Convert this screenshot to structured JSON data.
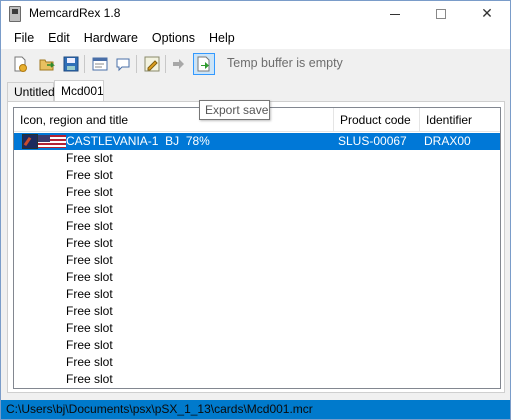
{
  "window": {
    "title": "MemcardRex 1.8",
    "icon": "memory-card-icon",
    "controls": {
      "minimize_icon": "minimize-icon",
      "maximize_icon": "maximize-icon",
      "close_icon": "close-icon"
    }
  },
  "menu": {
    "items": [
      "File",
      "Edit",
      "Hardware",
      "Options",
      "Help"
    ]
  },
  "toolbar": {
    "buttons": [
      {
        "name": "new-card",
        "icon": "new-file-icon"
      },
      {
        "name": "open-card",
        "icon": "open-folder-icon"
      },
      {
        "name": "save-card",
        "icon": "floppy-disk-icon"
      },
      {
        "name": "edit-header",
        "icon": "edit-header-icon"
      },
      {
        "name": "edit-comment",
        "icon": "comment-bubble-icon"
      },
      {
        "name": "edit-icon",
        "icon": "paint-icon"
      },
      {
        "name": "import-save",
        "icon": "import-arrow-icon"
      },
      {
        "name": "export-save",
        "icon": "export-arrow-icon"
      }
    ],
    "temp_buffer_text": "Temp buffer is empty"
  },
  "tabs": [
    {
      "label": "Untitled",
      "active": false
    },
    {
      "label": "Mcd001",
      "active": true
    }
  ],
  "tooltip": {
    "text": "Export save"
  },
  "list": {
    "columns": [
      "Icon, region and title",
      "Product code",
      "Identifier"
    ],
    "rows": [
      {
        "title": "CASTLEVANIA-1  BJ  78%",
        "product_code": "SLUS-00067",
        "identifier": "DRAX00",
        "selected": true,
        "icon": "save-icon",
        "region": "us-flag-icon"
      },
      {
        "title": "Free slot",
        "product_code": "",
        "identifier": ""
      },
      {
        "title": "Free slot",
        "product_code": "",
        "identifier": ""
      },
      {
        "title": "Free slot",
        "product_code": "",
        "identifier": ""
      },
      {
        "title": "Free slot",
        "product_code": "",
        "identifier": ""
      },
      {
        "title": "Free slot",
        "product_code": "",
        "identifier": ""
      },
      {
        "title": "Free slot",
        "product_code": "",
        "identifier": ""
      },
      {
        "title": "Free slot",
        "product_code": "",
        "identifier": ""
      },
      {
        "title": "Free slot",
        "product_code": "",
        "identifier": ""
      },
      {
        "title": "Free slot",
        "product_code": "",
        "identifier": ""
      },
      {
        "title": "Free slot",
        "product_code": "",
        "identifier": ""
      },
      {
        "title": "Free slot",
        "product_code": "",
        "identifier": ""
      },
      {
        "title": "Free slot",
        "product_code": "",
        "identifier": ""
      },
      {
        "title": "Free slot",
        "product_code": "",
        "identifier": ""
      },
      {
        "title": "Free slot",
        "product_code": "",
        "identifier": ""
      }
    ]
  },
  "statusbar": {
    "path": "C:\\Users\\bj\\Documents\\psx\\pSX_1_13\\cards\\Mcd001.mcr"
  },
  "colors": {
    "selection": "#0078d7",
    "statusbar": "#007acc",
    "toolbar_active": "#cce4f7"
  }
}
